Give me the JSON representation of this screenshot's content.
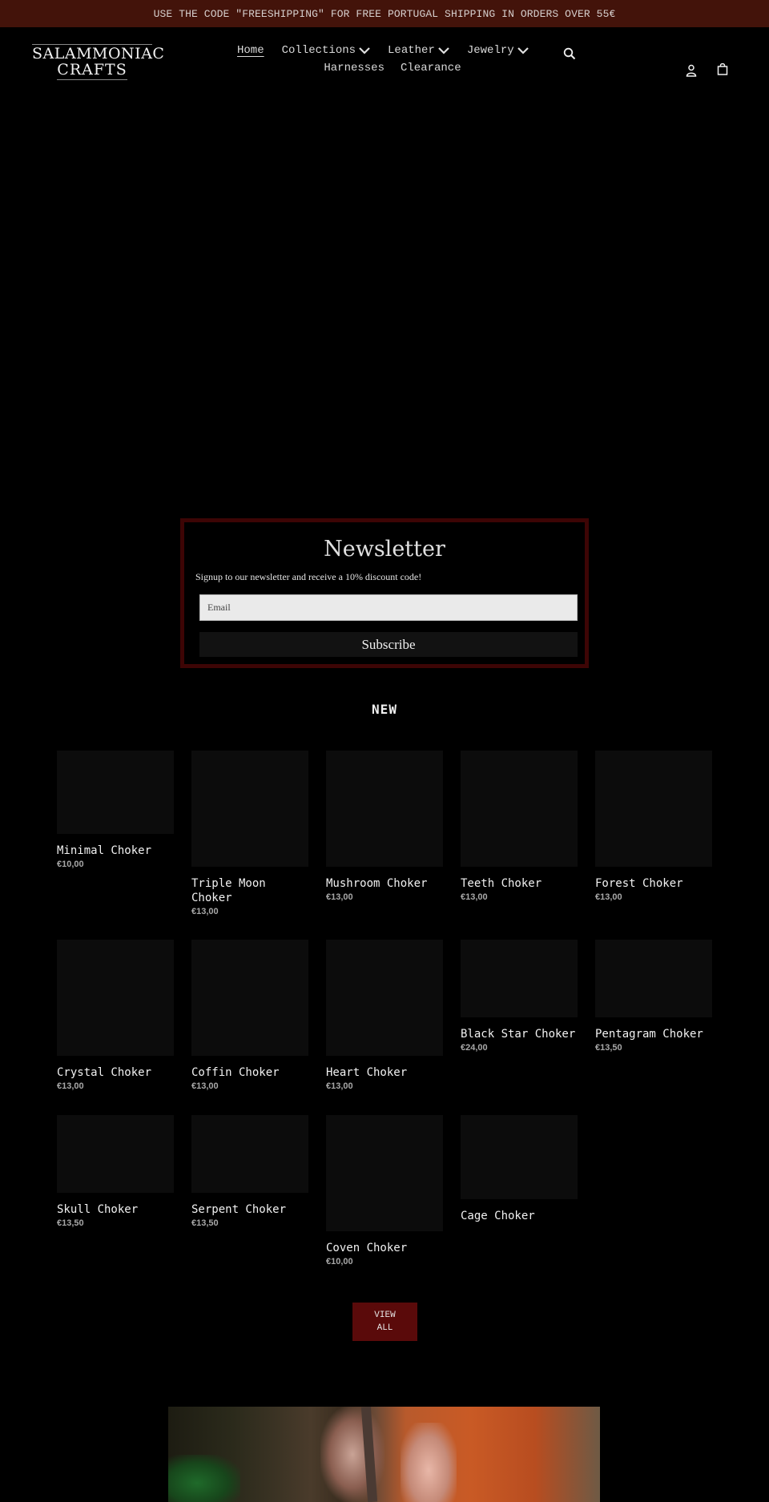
{
  "announcement": "USE THE CODE \"FREESHIPPING\" FOR FREE PORTUGAL SHIPPING IN ORDERS OVER 55€",
  "logo": {
    "line1": "SALAMMONIAC",
    "line2": "CRAFTS"
  },
  "nav": {
    "row1": [
      {
        "label": "Home",
        "active": true,
        "dropdown": false
      },
      {
        "label": "Collections",
        "dropdown": true
      },
      {
        "label": "Leather",
        "dropdown": true
      },
      {
        "label": "Jewelry",
        "dropdown": true
      }
    ],
    "row2": [
      {
        "label": "Harnesses"
      },
      {
        "label": "Clearance"
      }
    ]
  },
  "header_icons": {
    "search": "search-icon",
    "account": "account-icon",
    "cart": "cart-icon"
  },
  "newsletter": {
    "title": "Newsletter",
    "subtitle": "Signup to our newsletter and receive a 10% discount code!",
    "email_placeholder": "Email",
    "button": "Subscribe"
  },
  "colors": {
    "announcement_bg": "#43130a",
    "newsletter_border": "#3d0505",
    "view_all_bg": "#5a0a0a"
  },
  "collection": {
    "title": "NEW",
    "products": [
      {
        "name": "Minimal Choker",
        "price": "€10,00"
      },
      {
        "name": "Triple Moon Choker",
        "price": "€13,00"
      },
      {
        "name": "Mushroom Choker",
        "price": "€13,00"
      },
      {
        "name": "Teeth Choker",
        "price": "€13,00"
      },
      {
        "name": "Forest Choker",
        "price": "€13,00"
      },
      {
        "name": "Crystal Choker",
        "price": "€13,00"
      },
      {
        "name": "Coffin Choker",
        "price": "€13,00"
      },
      {
        "name": "Heart Choker",
        "price": "€13,00"
      },
      {
        "name": "Black Star Choker",
        "price": "€24,00"
      },
      {
        "name": "Pentagram Choker",
        "price": "€13,50"
      },
      {
        "name": "Skull Choker",
        "price": "€13,50"
      },
      {
        "name": "Serpent Choker",
        "price": "€13,50"
      },
      {
        "name": "Coven Choker",
        "price": "€10,00"
      },
      {
        "name": "Cage Choker",
        "price": ""
      }
    ],
    "view_all": "VIEW ALL"
  }
}
